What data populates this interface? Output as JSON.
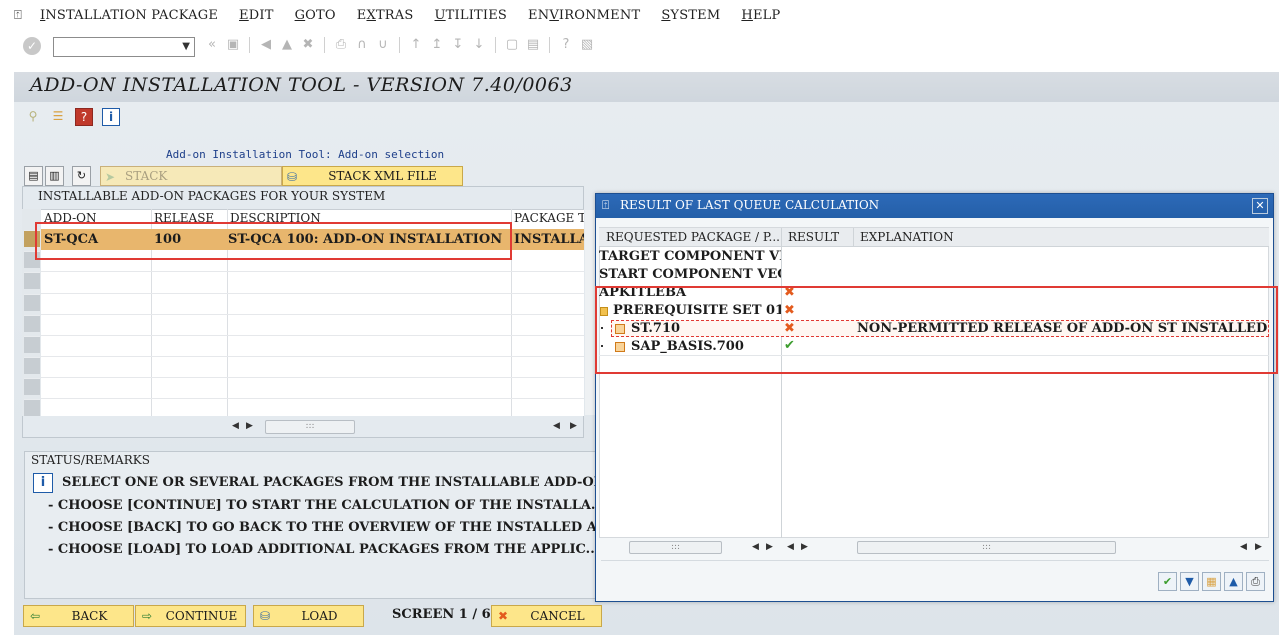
{
  "menubar": {
    "items": [
      {
        "label": "Installation Package",
        "ul": "I"
      },
      {
        "label": "Edit",
        "ul": "E"
      },
      {
        "label": "Goto",
        "ul": "G"
      },
      {
        "label": "Extras",
        "ul": "x"
      },
      {
        "label": "Utilities",
        "ul": "U"
      },
      {
        "label": "Environment",
        "ul": "v"
      },
      {
        "label": "System",
        "ul": "S"
      },
      {
        "label": "Help",
        "ul": "H"
      }
    ]
  },
  "toolbar": {
    "command_field_value": ""
  },
  "title": "Add-On Installation Tool - Version 7.40/0063",
  "subtitle": "Add-on Installation Tool: Add-on selection",
  "buttons": {
    "stack_config": "Stack Configuration",
    "stack_xml": "Stack XML File"
  },
  "packages_table": {
    "caption": "Installable Add-On Packages for Your System",
    "columns": [
      "Add-On",
      "Release",
      "Description",
      "Package T"
    ],
    "rows": [
      {
        "addon": "ST-QCA",
        "release": "100",
        "description": "ST-QCA 100: Add-on installation",
        "package_type": "Installa"
      }
    ]
  },
  "status": {
    "header": "Status/Remarks",
    "lines": [
      "Select one or several packages from the installable add-on p",
      "- Choose [Continue] to start the calculation of the installa...",
      "- Choose [Back] to go back to the overview of the installed a...",
      "- Choose [Load] to load additional packages from the applic..."
    ]
  },
  "footer": {
    "back": "Back",
    "continue": "Continue",
    "load": "Load",
    "screen": "Screen 1 / 6",
    "cancel": "Cancel"
  },
  "dialog": {
    "title": "Result of Last Queue Calculation",
    "columns": [
      "Requested Package / P...",
      "Result",
      "Explanation"
    ],
    "rows": [
      {
        "name": "Target Component Vec",
        "result": "",
        "explanation": ""
      },
      {
        "name": "Start Component Vect",
        "result": "",
        "explanation": ""
      },
      {
        "name": "APKITLEBA",
        "result": "x",
        "explanation": ""
      },
      {
        "name": "Prerequisite Set 01",
        "result": "x",
        "explanation": ""
      },
      {
        "name": "ST.710",
        "result": "x",
        "explanation": "Non-permitted release of add-on ST installed"
      },
      {
        "name": "SAP_BASIS.700",
        "result": "ok",
        "explanation": ""
      }
    ]
  },
  "colors": {
    "selected_row": "#e8b66d",
    "highlight_box": "#e03a34",
    "dialog_title_bar": "#245fa8",
    "button_yellow": "#fde68a",
    "error_mark": "#e35b1e",
    "ok_mark": "#3c9d2e"
  }
}
